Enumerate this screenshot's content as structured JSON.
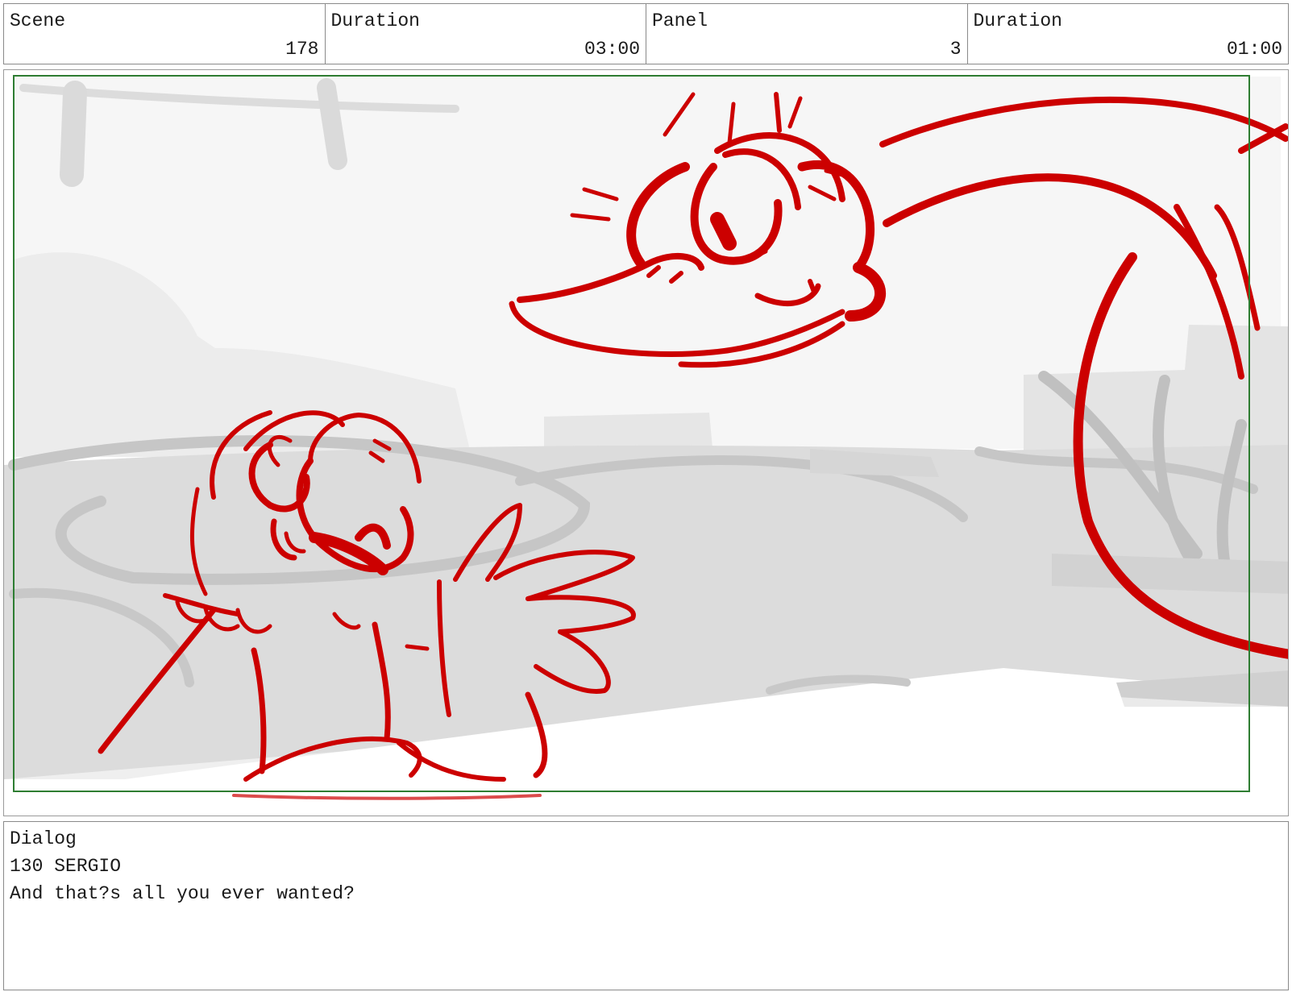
{
  "header": {
    "cells": [
      {
        "label": "Scene",
        "value": "178"
      },
      {
        "label": "Duration",
        "value": "03:00"
      },
      {
        "label": "Panel",
        "value": "3"
      },
      {
        "label": "Duration",
        "value": "01:00"
      }
    ]
  },
  "dialog": {
    "heading": "Dialog",
    "lines": [
      "130 SERGIO",
      "And that?s all you ever wanted?"
    ]
  },
  "colors": {
    "sketch_red": "#cc0000",
    "safe_frame_green": "#2e7d32",
    "background_gray": "#d9d9d9",
    "border_gray": "#8a8a8a"
  },
  "icons": {
    "drawing": "storyboard-sketch"
  }
}
